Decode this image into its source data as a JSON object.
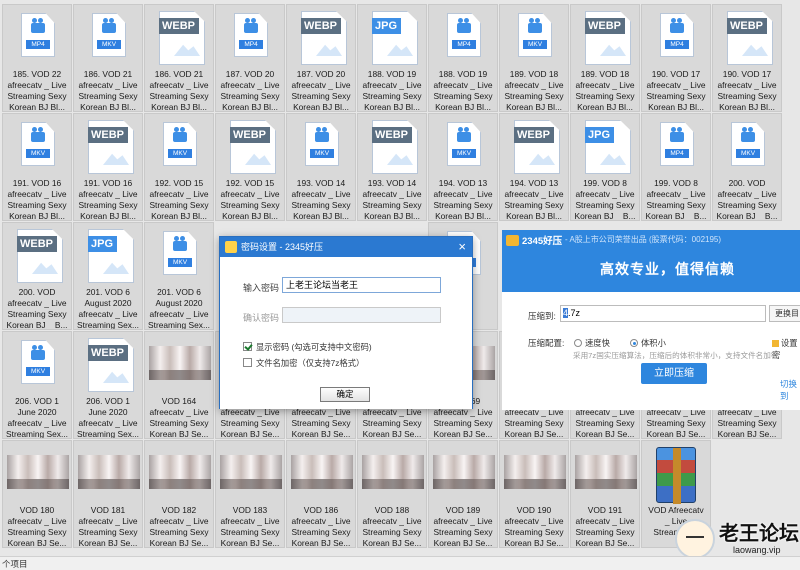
{
  "files": [
    {
      "type": "doc",
      "badge": "MP4",
      "label": "185. VOD 22\nafreecatv _ Live\nStreaming Sexy\nKorean BJ Bl..."
    },
    {
      "type": "doc",
      "badge": "MKV",
      "label": "186. VOD 21\nafreecatv _ Live\nStreaming Sexy\nKorean BJ Bl..."
    },
    {
      "type": "img",
      "badge": "WEBP",
      "label": "186. VOD 21\nafreecatv _ Live\nStreaming Sexy\nKorean BJ Bl..."
    },
    {
      "type": "doc",
      "badge": "MP4",
      "label": "187. VOD 20\nafreecatv _ Live\nStreaming Sexy\nKorean BJ Bl..."
    },
    {
      "type": "img",
      "badge": "WEBP",
      "label": "187. VOD 20\nafreecatv _ Live\nStreaming Sexy\nKorean BJ Bl..."
    },
    {
      "type": "img",
      "badge": "JPG",
      "label": "188. VOD 19\nafreecatv _ Live\nStreaming Sexy\nKorean BJ Bl..."
    },
    {
      "type": "doc",
      "badge": "MP4",
      "label": "188. VOD 19\nafreecatv _ Live\nStreaming Sexy\nKorean BJ Bl..."
    },
    {
      "type": "doc",
      "badge": "MKV",
      "label": "189. VOD 18\nafreecatv _ Live\nStreaming Sexy\nKorean BJ Bl..."
    },
    {
      "type": "img",
      "badge": "WEBP",
      "label": "189. VOD 18\nafreecatv _ Live\nStreaming Sexy\nKorean BJ Bl..."
    },
    {
      "type": "doc",
      "badge": "MP4",
      "label": "190. VOD 17\nafreecatv _ Live\nStreaming Sexy\nKorean BJ Bl..."
    },
    {
      "type": "img",
      "badge": "WEBP",
      "label": "190. VOD 17\nafreecatv _ Live\nStreaming Sexy\nKorean BJ Bl..."
    },
    {
      "type": "doc",
      "badge": "MKV",
      "label": "191. VOD 16\nafreecatv _ Live\nStreaming Sexy\nKorean BJ Bl..."
    },
    {
      "type": "img",
      "badge": "WEBP",
      "label": "191. VOD 16\nafreecatv _ Live\nStreaming Sexy\nKorean BJ Bl..."
    },
    {
      "type": "doc",
      "badge": "MKV",
      "label": "192. VOD 15\nafreecatv _ Live\nStreaming Sexy\nKorean BJ Bl..."
    },
    {
      "type": "img",
      "badge": "WEBP",
      "label": "192. VOD 15\nafreecatv _ Live\nStreaming Sexy\nKorean BJ Bl..."
    },
    {
      "type": "doc",
      "badge": "MKV",
      "label": "193. VOD 14\nafreecatv _ Live\nStreaming Sexy\nKorean BJ Bl..."
    },
    {
      "type": "img",
      "badge": "WEBP",
      "label": "193. VOD 14\nafreecatv _ Live\nStreaming Sexy\nKorean BJ Bl..."
    },
    {
      "type": "doc",
      "badge": "MKV",
      "label": "194. VOD 13\nafreecatv _ Live\nStreaming Sexy\nKorean BJ Bl..."
    },
    {
      "type": "img",
      "badge": "WEBP",
      "label": "194. VOD 13\nafreecatv _ Live\nStreaming Sexy\nKorean BJ Bl..."
    },
    {
      "type": "img",
      "badge": "JPG",
      "label": "199. VOD 8\nafreecatv _ Live\nStreaming Sexy\nKorean BJ _ B..."
    },
    {
      "type": "doc",
      "badge": "MP4",
      "label": "199. VOD 8\nafreecatv _ Live\nStreaming Sexy\nKorean BJ _ B..."
    },
    {
      "type": "doc",
      "badge": "MKV",
      "label": "200. VOD\nafreecatv _ Live\nStreaming Sexy\nKorean BJ _ B..."
    },
    {
      "type": "img",
      "badge": "WEBP",
      "label": "200. VOD\nafreecatv _ Live\nStreaming Sexy\nKorean BJ _ B..."
    },
    {
      "type": "img",
      "badge": "JPG",
      "label": "201. VOD 6\nAugust 2020\nafreecatv _ Live\nStreaming Sex..."
    },
    {
      "type": "doc",
      "badge": "MKV",
      "label": "201. VOD 6\nAugust 2020\nafreecatv _ Live\nStreaming Sex..."
    },
    {
      "type": "hidden"
    },
    {
      "type": "hidden"
    },
    {
      "type": "hidden"
    },
    {
      "type": "doc",
      "badge": "MP4",
      "label": "4\nLive\nSexy\nSe..."
    },
    {
      "type": "hidden"
    },
    {
      "type": "hidden"
    },
    {
      "type": "hidden"
    },
    {
      "type": "hidden"
    },
    {
      "type": "doc",
      "badge": "MKV",
      "label": "206. VOD 1\nJune 2020\nafreecatv _ Live\nStreaming Sex..."
    },
    {
      "type": "img",
      "badge": "WEBP",
      "label": "206. VOD 1\nJune 2020\nafreecatv _ Live\nStreaming Sex..."
    },
    {
      "type": "photo",
      "label": "VOD 164\nafreecatv _ Live\nStreaming Sexy\nKorean BJ Se..."
    },
    {
      "type": "photo",
      "label": "VOD 165\nafreecatv _ Live\nStreaming Sexy\nKorean BJ Se..."
    },
    {
      "type": "photo",
      "label": "VOD 166\nafreecatv _ Live\nStreaming Sexy\nKorean BJ Se..."
    },
    {
      "type": "photo",
      "label": "VOD 167\nafreecatv _ Live\nStreaming Sexy\nKorean BJ Se..."
    },
    {
      "type": "photo",
      "label": "VOD 169\nafreecatv _ Live\nStreaming Sexy\nKorean BJ Se..."
    },
    {
      "type": "photo",
      "label": "VOD 170\nafreecatv _ Live\nStreaming Sexy\nKorean BJ Se..."
    },
    {
      "type": "photo",
      "label": "VOD 172\nafreecatv _ Live\nStreaming Sexy\nKorean BJ Se..."
    },
    {
      "type": "photo",
      "label": "VOD 178\nafreecatv _ Live\nStreaming Sexy\nKorean BJ Se..."
    },
    {
      "type": "photo",
      "label": "VOD 179\nafreecatv _ Live\nStreaming Sexy\nKorean BJ Se..."
    },
    {
      "type": "photo",
      "label": "VOD 180\nafreecatv _ Live\nStreaming Sexy\nKorean BJ Se..."
    },
    {
      "type": "photo",
      "label": "VOD 181\nafreecatv _ Live\nStreaming Sexy\nKorean BJ Se..."
    },
    {
      "type": "photo",
      "label": "VOD 182\nafreecatv _ Live\nStreaming Sexy\nKorean BJ Se..."
    },
    {
      "type": "photo",
      "label": "VOD 183\nafreecatv _ Live\nStreaming Sexy\nKorean BJ Se..."
    },
    {
      "type": "photo",
      "label": "VOD 186\nafreecatv _ Live\nStreaming Sexy\nKorean BJ Se..."
    },
    {
      "type": "photo",
      "label": "VOD 188\nafreecatv _ Live\nStreaming Sexy\nKorean BJ Se..."
    },
    {
      "type": "photo",
      "label": "VOD 189\nafreecatv _ Live\nStreaming Sexy\nKorean BJ Se..."
    },
    {
      "type": "photo",
      "label": "VOD 190\nafreecatv _ Live\nStreaming Sexy\nKorean BJ Se..."
    },
    {
      "type": "photo",
      "label": "VOD 191\nafreecatv _ Live\nStreaming Sexy\nKorean BJ Se..."
    },
    {
      "type": "rar",
      "label": "VOD Afreecatv\n_ Live\nStreaming..."
    },
    {
      "type": "hidden"
    }
  ],
  "password_dialog": {
    "title": "密码设置 - 2345好压",
    "close": "×",
    "enter_label": "输入密码",
    "enter_value": "上老王论坛当老王",
    "confirm_label": "确认密码",
    "confirm_value": "",
    "show_password": "显示密码 (勾选可支持中文密码)",
    "show_password_checked": true,
    "encrypt_names": "文件名加密（仅支持7z格式）",
    "encrypt_names_checked": false,
    "ok": "确定"
  },
  "compressor": {
    "brand": "2345好压",
    "subtitle": "- A股上市公司荣誉出品 (股票代码：002195)",
    "slogan": "高效专业，值得信赖",
    "dest_label": "压缩到:",
    "dest_selected": "4",
    "dest_rest": ".7z",
    "change_btn": "更换目",
    "config_label": "压缩配置:",
    "opt_fast": "速度快",
    "opt_small": "体积小",
    "selected_option": "体积小",
    "pwd_setting": "设置密",
    "hint": "采用7z国实压缩算法，压缩后的体积非常小，支持文件名加密",
    "compress_btn": "立即压缩",
    "switch_link": "切换到",
    "colors": {
      "accent": "#2e86de"
    }
  },
  "status_bar": {
    "text": "个项目"
  },
  "watermark": {
    "text": "老王论坛",
    "site": "laowang.vip"
  }
}
